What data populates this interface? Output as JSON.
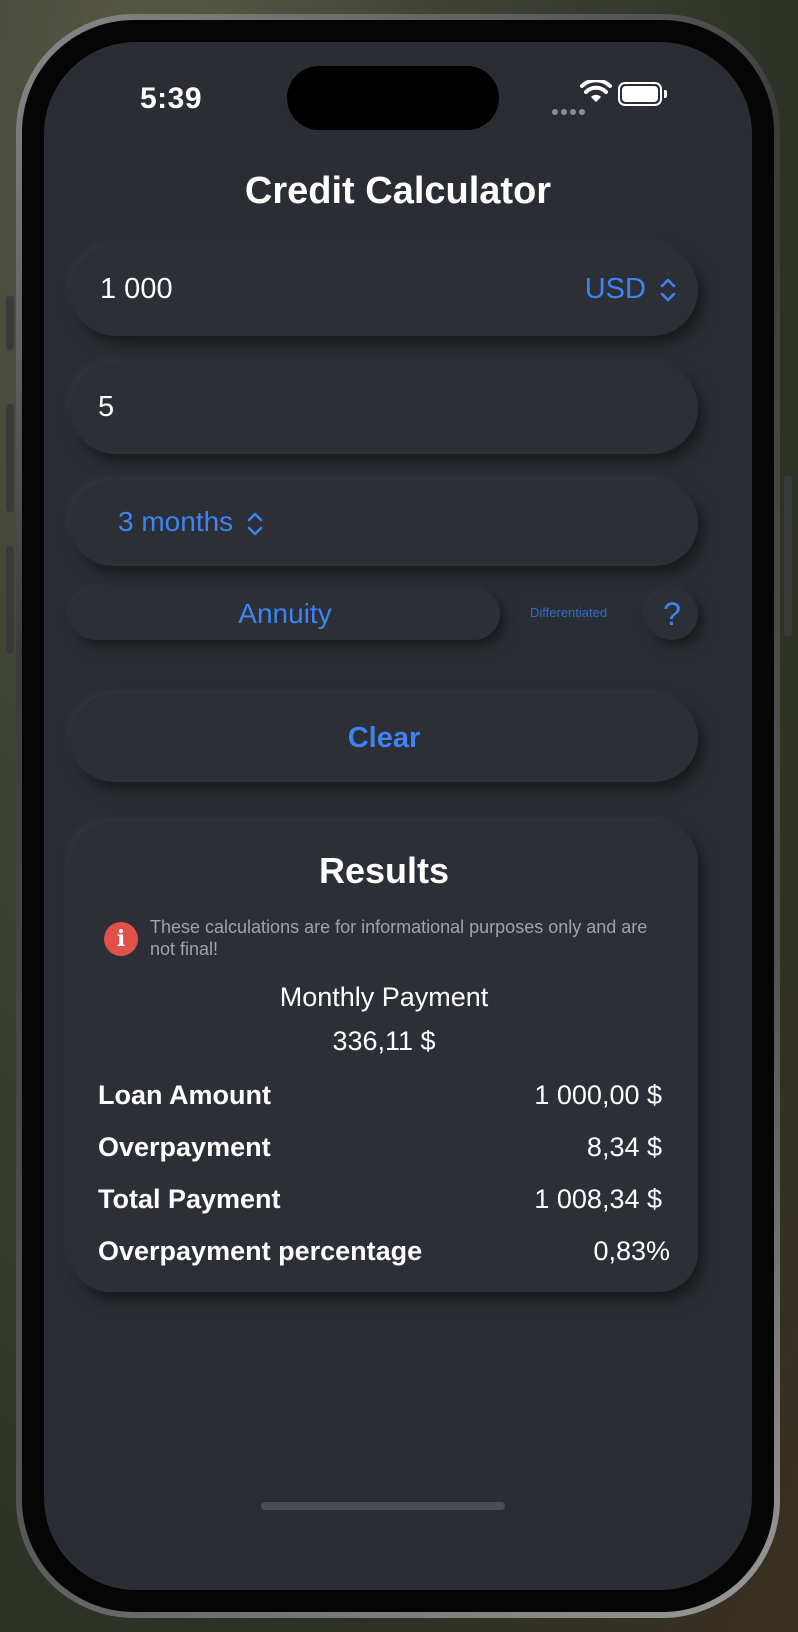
{
  "status": {
    "time": "5:39"
  },
  "header": {
    "title": "Credit Calculator"
  },
  "form": {
    "amount_value": "1 000",
    "currency_label": "USD",
    "rate_value": "5",
    "term_label": "3 months",
    "type_annuity": "Annuity",
    "type_differentiated": "Differentiated",
    "help_label": "?",
    "clear_label": "Clear"
  },
  "results": {
    "title": "Results",
    "info_glyph": "i",
    "disclaimer": "These calculations are for informational purposes only and are not final!",
    "monthly_payment_label": "Monthly Payment",
    "monthly_payment_value": "336,11 $",
    "rows": [
      {
        "label": "Loan Amount",
        "value": "1 000,00 $"
      },
      {
        "label": "Overpayment",
        "value": "8,34 $"
      },
      {
        "label": "Total Payment",
        "value": "1 008,34 $"
      },
      {
        "label": "Overpayment percentage",
        "value": "0,83%"
      }
    ]
  },
  "colors": {
    "accent": "#3d84f2",
    "background": "#2a2d33",
    "warning": "#e2504a"
  }
}
